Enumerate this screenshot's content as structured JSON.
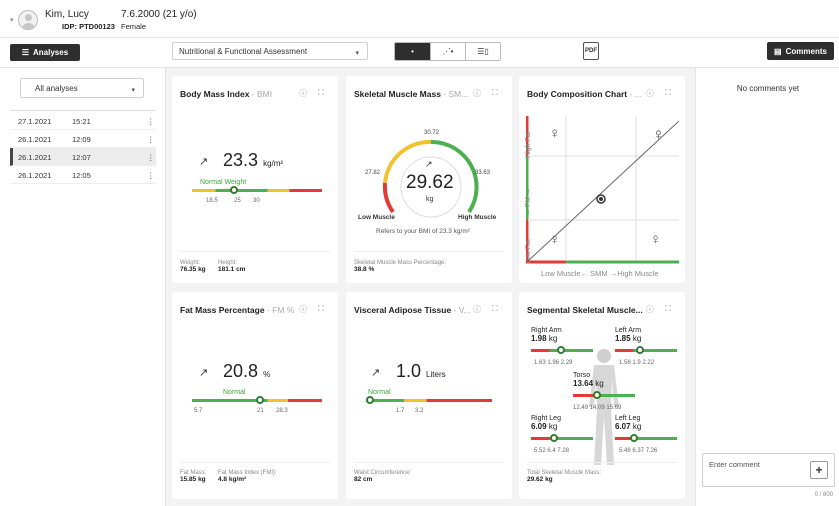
{
  "header": {
    "patient_name": "Kim, Lucy",
    "patient_id": "IDP: PTD00123",
    "dob": "7.6.2000 (21 y/o)",
    "sex": "Female"
  },
  "toolbar": {
    "analyses_label": "Analyses",
    "assessment_select": "Nutritional & Functional Assessment",
    "pdf_label": "PDF",
    "comments_label": "Comments"
  },
  "sidebar": {
    "filter": "All analyses",
    "rows": [
      {
        "date": "27.1.2021",
        "time": "15:21"
      },
      {
        "date": "26.1.2021",
        "time": "12:09"
      },
      {
        "date": "26.1.2021",
        "time": "12:07"
      },
      {
        "date": "26.1.2021",
        "time": "12:05"
      }
    ]
  },
  "cards": {
    "bmi": {
      "title": "Body Mass Index",
      "sub": " - BMI",
      "value": "23.3",
      "unit": "kg/m²",
      "range_label": "Normal Weight",
      "ticks": [
        "18.5",
        "25",
        "30"
      ],
      "foot1_label": "Weight:",
      "foot1_value": "76.35 kg",
      "foot2_label": "Height:",
      "foot2_value": "181.1 cm"
    },
    "smm": {
      "title": "Skeletal Muscle Mass",
      "sub": " - SM...",
      "value": "29.62",
      "unit": "kg",
      "top": "30.72",
      "left": "27.82",
      "right": "33.63",
      "low": "Low Muscle",
      "high": "High Muscle",
      "note": "Refers to your BMI of 23.3 kg/m²",
      "foot_label": "Skeletal Muscle Mass Percentage:",
      "foot_value": "38.8 %"
    },
    "bcc": {
      "title": "Body Composition Chart",
      "sub": " - ...",
      "yaxis_high": "High Fat",
      "yaxis_mid": "← FM →",
      "yaxis_low": "Low Fat",
      "xaxis": "Low Muscle← SMM →High Muscle"
    },
    "fm": {
      "title": "Fat Mass Percentage",
      "sub": " - FM %",
      "value": "20.8",
      "unit": "%",
      "range_label": "Normal",
      "ticks": [
        "5.7",
        "21",
        "28.3"
      ],
      "foot1_label": "Fat Mass:",
      "foot1_value": "15.85 kg",
      "foot2_label": "Fat Mass Index (FMI):",
      "foot2_value": "4.8 kg/m²"
    },
    "vat": {
      "title": "Visceral Adipose Tissue",
      "sub": " - V...",
      "value": "1.0",
      "unit": "Liters",
      "range_label": "Normal",
      "ticks": [
        "1.7",
        "3.2"
      ],
      "foot_label": "Waist Circumference:",
      "foot_value": "82 cm"
    },
    "seg": {
      "title": "Segmental Skeletal Muscle...",
      "ra_label": "Right Arm",
      "ra_value": "1.98",
      "ra_ticks": "1.63  1.96  2.29",
      "la_label": "Left Arm",
      "la_value": "1.85",
      "la_ticks": "1.58   1.9   2.22",
      "t_label": "Torso",
      "t_value": "13.64",
      "t_ticks": "12.49 14.09 15.69",
      "rl_label": "Right Leg",
      "rl_value": "6.09",
      "rl_ticks": "5.52  6.4  7.28",
      "ll_label": "Left Leg",
      "ll_value": "6.07",
      "ll_ticks": "5.48  6.37  7.26",
      "unit": "kg",
      "foot_label": "Total Skeletal Muscle Mass:",
      "foot_value": "29.62 kg"
    }
  },
  "comments": {
    "empty": "No comments yet",
    "placeholder": "Enter comment",
    "counter": "0 / 800",
    "add": "+"
  },
  "colors": {
    "red": "#e53935",
    "yellow": "#f2c12e",
    "green": "#4caf50"
  }
}
